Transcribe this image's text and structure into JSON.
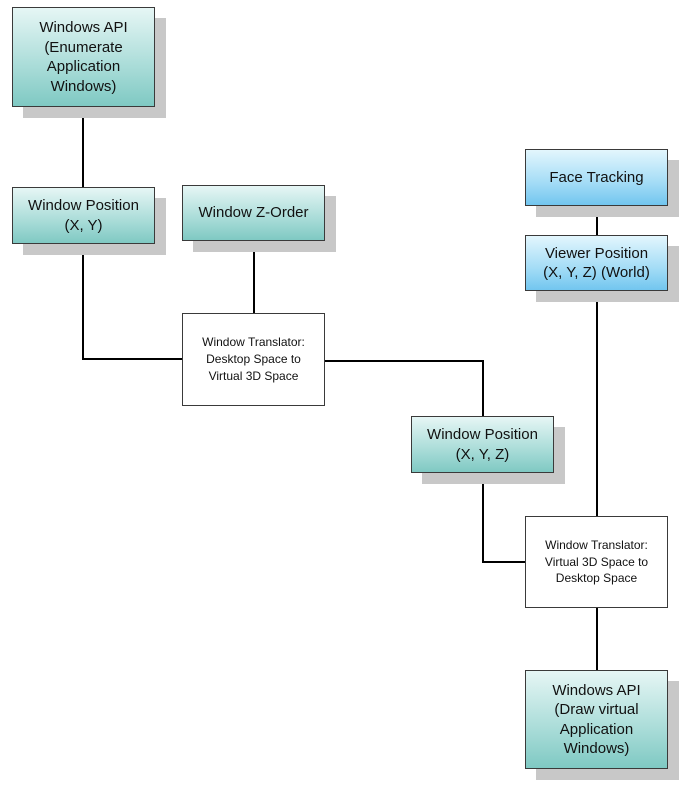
{
  "diagram": {
    "nodes": [
      {
        "id": "winapi-enum",
        "text": "Windows API\n(Enumerate\nApplication\nWindows)",
        "style": "teal"
      },
      {
        "id": "window-position-xy",
        "text": "Window Position\n(X, Y)",
        "style": "teal"
      },
      {
        "id": "window-z-order",
        "text": "Window Z-Order",
        "style": "teal"
      },
      {
        "id": "translator-desktop-to-3d",
        "text": "Window Translator:\nDesktop Space to\nVirtual 3D Space",
        "style": "white"
      },
      {
        "id": "face-tracking",
        "text": "Face Tracking",
        "style": "blue"
      },
      {
        "id": "viewer-position",
        "text": "Viewer Position\n(X, Y, Z) (World)",
        "style": "blue"
      },
      {
        "id": "window-position-xyz",
        "text": "Window Position\n(X, Y, Z)",
        "style": "teal"
      },
      {
        "id": "translator-3d-to-desktop",
        "text": "Window Translator:\nVirtual 3D Space to\nDesktop Space",
        "style": "white"
      },
      {
        "id": "winapi-draw",
        "text": "Windows API\n(Draw virtual\nApplication\nWindows)",
        "style": "teal"
      }
    ],
    "edges": [
      {
        "from": "winapi-enum",
        "to": "window-position-xy"
      },
      {
        "from": "window-position-xy",
        "to": "translator-desktop-to-3d"
      },
      {
        "from": "window-z-order",
        "to": "translator-desktop-to-3d"
      },
      {
        "from": "translator-desktop-to-3d",
        "to": "window-position-xyz"
      },
      {
        "from": "face-tracking",
        "to": "viewer-position"
      },
      {
        "from": "viewer-position",
        "to": "translator-3d-to-desktop"
      },
      {
        "from": "window-position-xyz",
        "to": "translator-3d-to-desktop"
      },
      {
        "from": "translator-3d-to-desktop",
        "to": "winapi-draw"
      }
    ]
  }
}
